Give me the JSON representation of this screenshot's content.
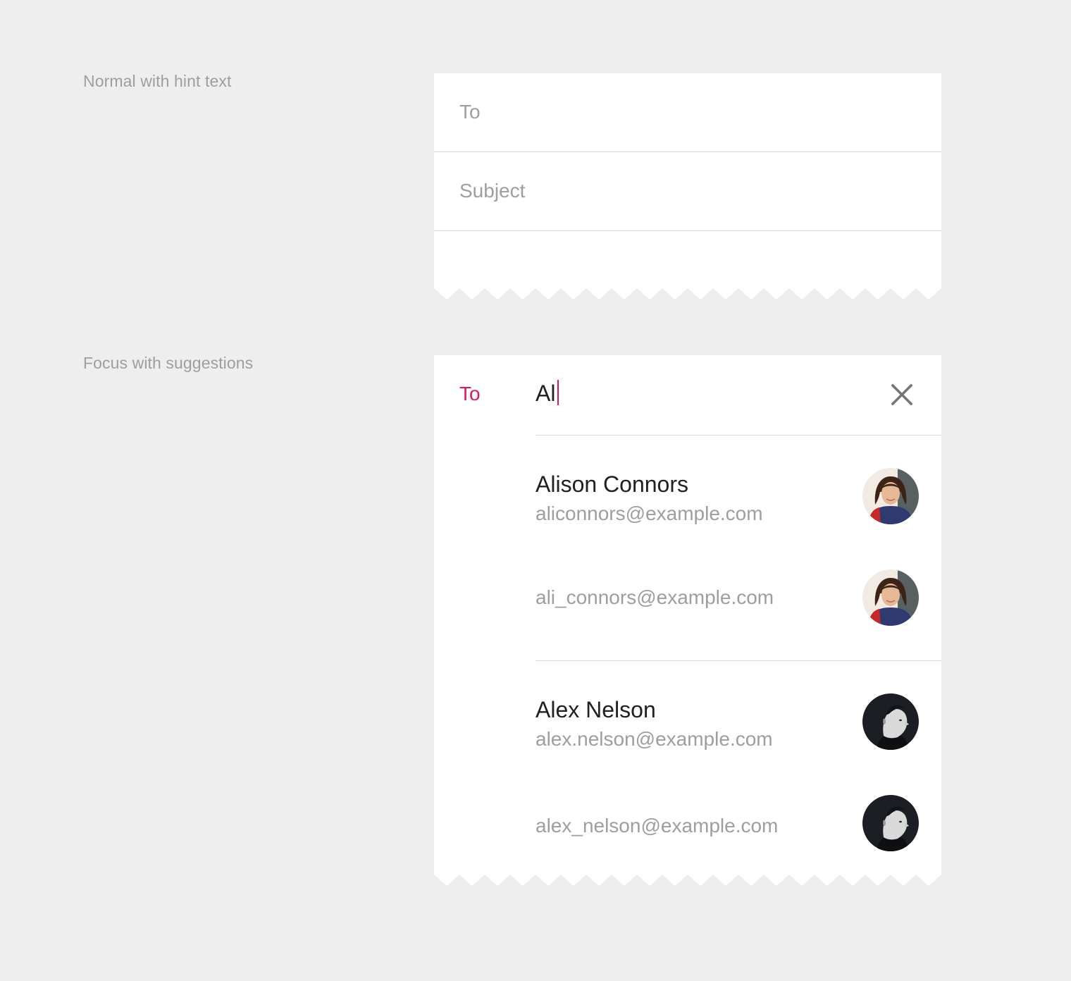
{
  "sections": {
    "normal": {
      "label": "Normal with hint text",
      "to_hint": "To",
      "subject_hint": "Subject"
    },
    "focus": {
      "label": "Focus with suggestions",
      "to_label": "To",
      "input_value": "Al",
      "clear_icon": "close-icon",
      "suggestions": [
        {
          "name": "Alison Connors",
          "email": "aliconnors@example.com",
          "avatar": "woman-avatar"
        },
        {
          "name": "",
          "email": "ali_connors@example.com",
          "avatar": "woman-avatar"
        },
        {
          "name": "Alex Nelson",
          "email": "alex.nelson@example.com",
          "avatar": "man-avatar"
        },
        {
          "name": "",
          "email": "alex_nelson@example.com",
          "avatar": "man-avatar"
        }
      ]
    }
  },
  "colors": {
    "background": "#eeeeee",
    "card": "#ffffff",
    "accent": "#d81b60",
    "hint": "#9e9e9e",
    "primary_text": "#212121",
    "divider": "#d9d9d9"
  }
}
